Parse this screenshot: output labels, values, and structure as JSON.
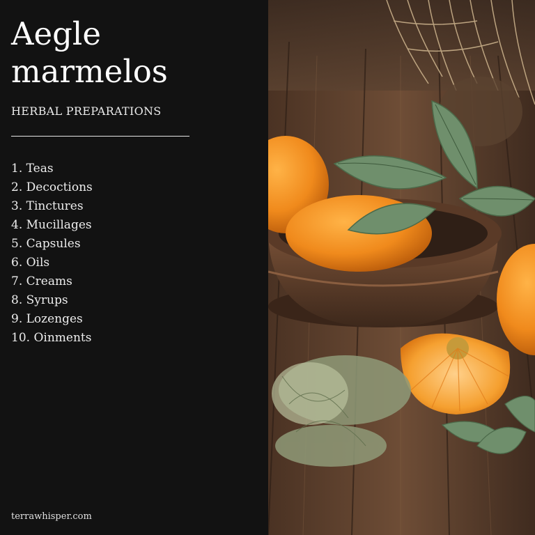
{
  "panel": {
    "title_line1": "Aegle",
    "title_line2": "marmelos",
    "subtitle": "HERBAL PREPARATIONS",
    "items": [
      "1. Teas",
      "2. Decoctions",
      "3. Tinctures",
      "4. Mucillages",
      "5. Capsules",
      "6. Oils",
      "7. Creams",
      "8. Syrups",
      "9. Lozenges",
      "10. Oinments"
    ],
    "footer": "terrawhisper.com"
  },
  "colors": {
    "panel_bg": "#121212",
    "text": "#ffffff",
    "wood": "#6b4a34",
    "fruit": "#f08a1c",
    "leaf": "#6f8f6c"
  },
  "photo": {
    "subject": "bael fruit halves, green leaves and dried herbs in a wooden bowl on a rustic table"
  }
}
